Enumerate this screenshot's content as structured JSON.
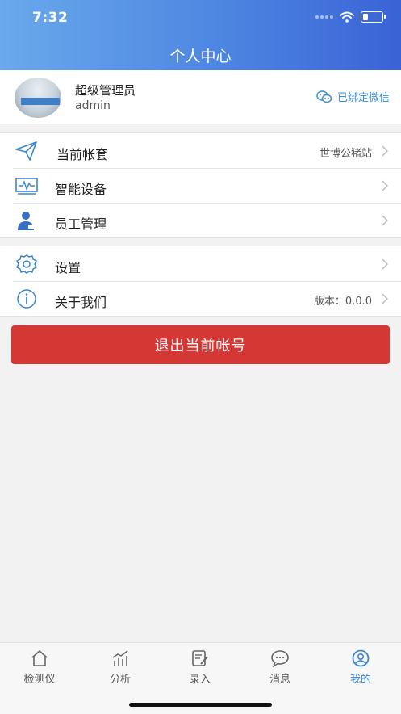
{
  "status_bar": {
    "time": "7:32",
    "battery_level": 0.25
  },
  "header": {
    "title": "个人中心"
  },
  "profile": {
    "name": "超级管理员",
    "username": "admin",
    "wechat_label": "已绑定微信",
    "wechat_icon": "wechat-icon"
  },
  "menu_group_1": [
    {
      "label": "当前帐套",
      "value": "世博公猪站",
      "icon": "paper-plane-icon"
    },
    {
      "label": "智能设备",
      "value": "",
      "icon": "device-monitor-icon"
    },
    {
      "label": "员工管理",
      "value": "",
      "icon": "employee-icon"
    }
  ],
  "menu_group_2": [
    {
      "label": "设置",
      "value": "",
      "icon": "gear-icon"
    },
    {
      "label": "关于我们",
      "value": "版本：0.0.0",
      "icon": "info-icon"
    }
  ],
  "logout_label": "退出当前帐号",
  "tabbar": [
    {
      "label": "检测仪",
      "icon": "home-icon",
      "active": false
    },
    {
      "label": "分析",
      "icon": "chart-icon",
      "active": false
    },
    {
      "label": "录入",
      "icon": "edit-icon",
      "active": false
    },
    {
      "label": "消息",
      "icon": "message-icon",
      "active": false
    },
    {
      "label": "我的",
      "icon": "user-icon",
      "active": true
    }
  ],
  "colors": {
    "accent": "#3a86cf",
    "header_start": "#6aa9ec",
    "header_end": "#3a63d6",
    "danger": "#d43734"
  }
}
